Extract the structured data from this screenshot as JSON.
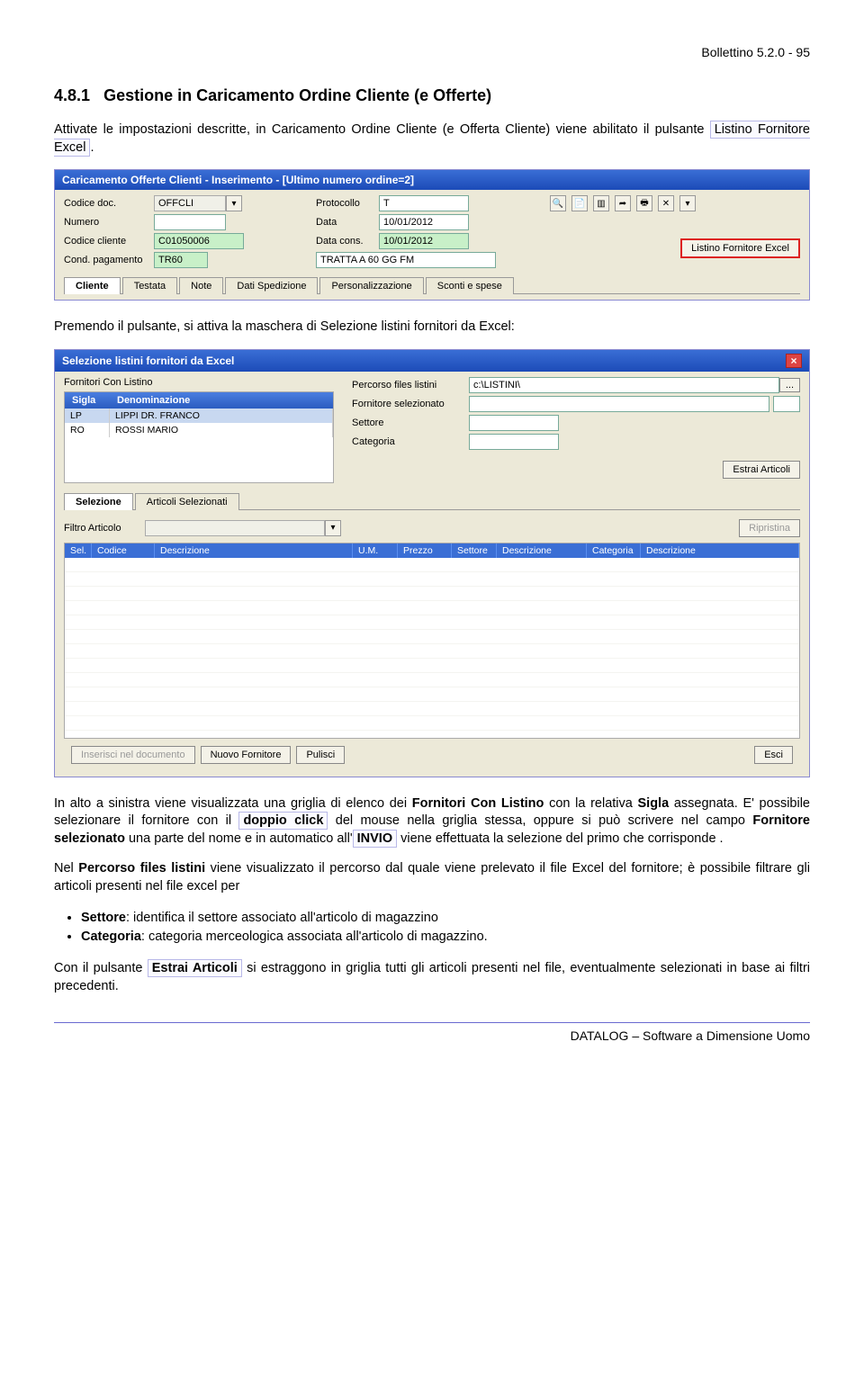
{
  "header": {
    "doc_ref": "Bollettino 5.2.0 - 95"
  },
  "section": {
    "number": "4.8.1",
    "title": "Gestione in Caricamento Ordine Cliente (e Offerte)"
  },
  "para1_a": "Attivate le impostazioni descritte, in Caricamento Ordine Cliente (e Offerta Cliente) viene abilitato il pulsante ",
  "para1_box": "Listino Fornitore Excel",
  "para1_b": ".",
  "win1": {
    "title": "Caricamento Offerte Clienti - Inserimento - [Ultimo numero ordine=2]",
    "labels": {
      "codice_doc": "Codice doc.",
      "protocollo": "Protocollo",
      "numero": "Numero",
      "data": "Data",
      "codice_cliente": "Codice cliente",
      "data_cons": "Data cons.",
      "cond_pagamento": "Cond. pagamento"
    },
    "values": {
      "codice_doc": "OFFCLI",
      "protocollo": "T",
      "data": "10/01/2012",
      "codice_cliente": "C01050006",
      "data_cons": "10/01/2012",
      "cond_pagamento": "TR60",
      "cond_pagamento_desc": "TRATTA A 60 GG FM"
    },
    "btn_listino": "Listino Fornitore Excel",
    "tabs": [
      "Cliente",
      "Testata",
      "Note",
      "Dati Spedizione",
      "Personalizzazione",
      "Sconti e spese"
    ]
  },
  "para2": "Premendo il pulsante, si attiva la maschera di Selezione listini fornitori da Excel:",
  "win2": {
    "title": "Selezione listini fornitori da Excel",
    "fieldset_fornitori": "Fornitori Con Listino",
    "grid1_headers": [
      "Sigla",
      "Denominazione"
    ],
    "grid1_rows": [
      {
        "sigla": "LP",
        "denom": "LIPPI DR. FRANCO"
      },
      {
        "sigla": "RO",
        "denom": "ROSSI MARIO"
      }
    ],
    "right_labels": {
      "percorso": "Percorso files listini",
      "fornitore_sel": "Fornitore selezionato",
      "settore": "Settore",
      "categoria": "Categoria"
    },
    "right_values": {
      "percorso": "c:\\LISTINI\\"
    },
    "btn_estrai": "Estrai Articoli",
    "tabs": [
      "Selezione",
      "Articoli Selezionati"
    ],
    "filtro_label": "Filtro Articolo",
    "btn_ripristina": "Ripristina",
    "grid2_headers": [
      "Sel.",
      "Codice",
      "Descrizione",
      "U.M.",
      "Prezzo",
      "Settore",
      "Descrizione",
      "Categoria",
      "Descrizione"
    ],
    "bottom_buttons": {
      "inserisci": "Inserisci nel documento",
      "nuovo": "Nuovo Fornitore",
      "pulisci": "Pulisci",
      "esci": "Esci"
    }
  },
  "para3_a": "In alto a sinistra viene visualizzata una griglia di elenco dei ",
  "para3_b": "Fornitori Con Listino",
  "para3_c": " con la relativa ",
  "para3_d": "Sigla",
  "para3_e": " assegnata. E' possibile selezionare il  fornitore  con il ",
  "para3_f": "doppio click",
  "para3_g": " del mouse nella griglia stessa, oppure si può scrivere nel campo ",
  "para3_h": "Fornitore selezionato",
  "para3_i": " una parte del nome e in automatico  all'",
  "para3_j": "INVIO",
  "para3_k": " viene effettuata la selezione del primo che corrisponde .",
  "para4_a": "Nel ",
  "para4_b": "Percorso files listini",
  "para4_c": " viene visualizzato il percorso dal quale viene prelevato il file Excel del fornitore;  è possibile filtrare gli articoli presenti nel file excel per",
  "bullets": [
    {
      "b": "Settore",
      "t": ": identifica il settore associato all'articolo di magazzino"
    },
    {
      "b": "Categoria",
      "t": ": categoria merceologica associata all'articolo di magazzino."
    }
  ],
  "para5_a": "Con il pulsante ",
  "para5_box": "Estrai Articoli",
  "para5_b": " si estraggono in griglia tutti gli articoli presenti nel file, eventualmente selezionati in base ai filtri precedenti.",
  "footer": "DATALOG – Software a Dimensione Uomo"
}
